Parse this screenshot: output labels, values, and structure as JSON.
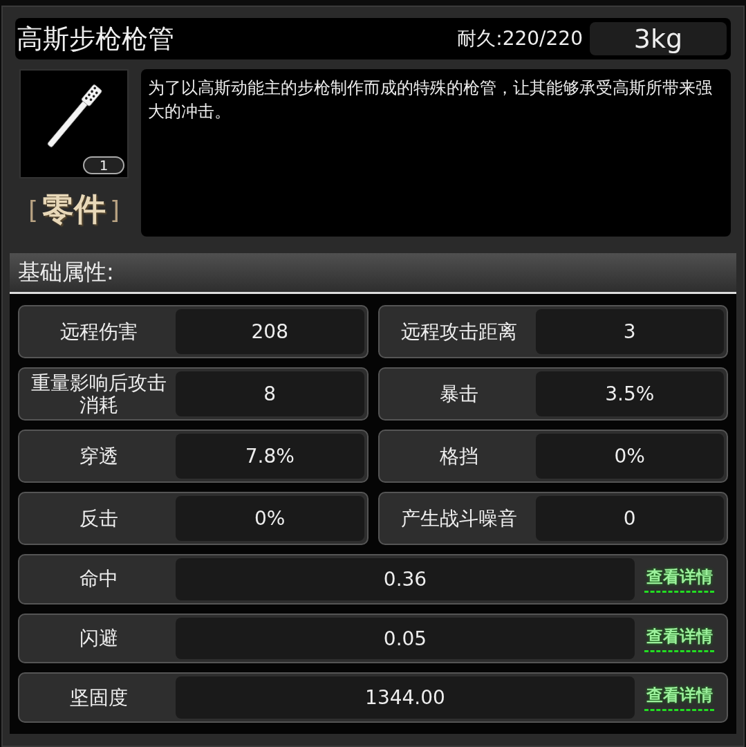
{
  "item": {
    "name": "高斯步枪枪管",
    "durability": "耐久:220/220",
    "weight": "3kg",
    "count": "1",
    "category": {
      "open": "[",
      "text": "零件",
      "close": "]"
    },
    "description": "为了以高斯动能主的步枪制作而成的特殊的枪管，让其能够承受高斯所带来强大的冲击。"
  },
  "section_title": "基础属性:",
  "stats": [
    {
      "label": "远程伤害",
      "value": "208"
    },
    {
      "label": "远程攻击距离",
      "value": "3"
    },
    {
      "label": "重量影响后攻击消耗",
      "value": "8"
    },
    {
      "label": "暴击",
      "value": "3.5%"
    },
    {
      "label": "穿透",
      "value": "7.8%"
    },
    {
      "label": "格挡",
      "value": "0%"
    },
    {
      "label": "反击",
      "value": "0%"
    },
    {
      "label": "产生战斗噪音",
      "value": "0"
    }
  ],
  "detail_rows": [
    {
      "label": "命中",
      "value": "0.36",
      "link": "查看详情"
    },
    {
      "label": "闪避",
      "value": "0.05",
      "link": "查看详情"
    },
    {
      "label": "坚固度",
      "value": "1344.00",
      "link": "查看详情"
    }
  ]
}
